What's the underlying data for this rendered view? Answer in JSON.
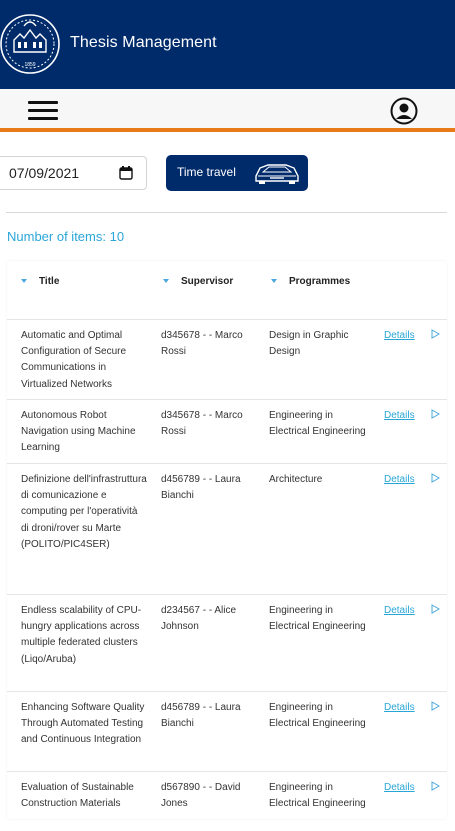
{
  "header": {
    "title": "Thesis Management",
    "logo_year": "1859",
    "brand_color": "#002b6b",
    "accent_color": "#e87a17"
  },
  "navbar": {
    "menu_icon": "hamburger-icon",
    "user_icon": "user-circle-icon"
  },
  "controls": {
    "date_value": "07/09/2021",
    "time_travel_label": "Time travel"
  },
  "list": {
    "count_text": "Number of items: 10",
    "columns": [
      "Title",
      "Supervisor",
      "Programmes"
    ],
    "details_label": "Details",
    "rows": [
      {
        "title": "Automatic and Optimal Configuration of Secure Communications in Virtualized Networks",
        "supervisor": "d345678 - - Marco Rossi",
        "programme": "Design in Graphic Design"
      },
      {
        "title": "Autonomous Robot Navigation using Machine Learning",
        "supervisor": "d345678 - - Marco Rossi",
        "programme": "Engineering in Electrical Engineering"
      },
      {
        "title": "Definizione dell'infrastruttura di comunicazione e computing per l'operatività di droni/rover su Marte (POLITO/PIC4SER)",
        "supervisor": "d456789 - - Laura Bianchi",
        "programme": "Architecture"
      },
      {
        "title": "Endless scalability of CPU-hungry applications across multiple federated clusters (Liqo/Aruba)",
        "supervisor": "d234567 - - Alice Johnson",
        "programme": "Engineering in Electrical Engineering"
      },
      {
        "title": "Enhancing Software Quality Through Automated Testing and Continuous Integration",
        "supervisor": "d456789 - - Laura Bianchi",
        "programme": "Engineering in Electrical Engineering"
      },
      {
        "title": "Evaluation of Sustainable Construction Materials",
        "supervisor": "d567890 - - David Jones",
        "programme": "Engineering in Electrical Engineering"
      }
    ]
  }
}
